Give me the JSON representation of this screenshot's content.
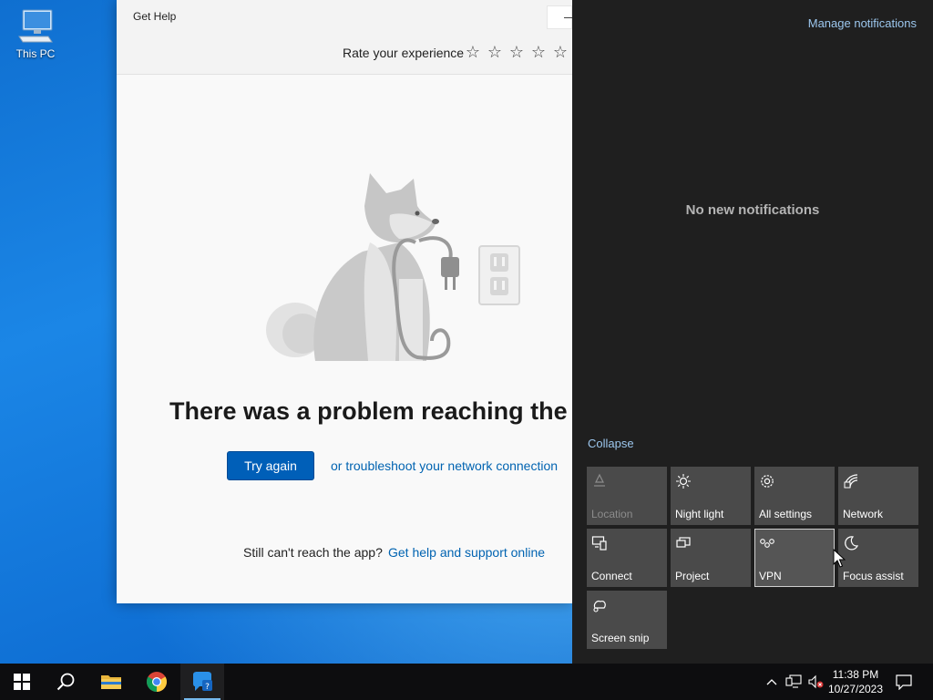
{
  "desktop": {
    "icons": [
      {
        "label": "This PC",
        "icon": "computer-icon"
      }
    ]
  },
  "get_help": {
    "title": "Get Help",
    "rate_label": "Rate your experience",
    "star_glyph": "☆",
    "rating": {
      "value": 0,
      "max": 5
    },
    "headline": "There was a problem reaching the a",
    "try_again": "Try again",
    "troubleshoot_link": "or troubleshoot your network connection",
    "still_cant": "Still can't reach the app?",
    "help_online_link": "Get help and support online"
  },
  "action_center": {
    "manage_notifications": "Manage notifications",
    "empty_message": "No new notifications",
    "collapse": "Collapse",
    "tiles": [
      {
        "label": "Location",
        "icon": "location-icon",
        "enabled": false
      },
      {
        "label": "Night light",
        "icon": "brightness-icon",
        "enabled": true
      },
      {
        "label": "All settings",
        "icon": "gear-icon",
        "enabled": true
      },
      {
        "label": "Network",
        "icon": "network-icon",
        "enabled": true
      },
      {
        "label": "Connect",
        "icon": "connect-icon",
        "enabled": true
      },
      {
        "label": "Project",
        "icon": "project-icon",
        "enabled": true
      },
      {
        "label": "VPN",
        "icon": "vpn-icon",
        "enabled": true
      },
      {
        "label": "Focus assist",
        "icon": "moon-icon",
        "enabled": true
      },
      {
        "label": "Screen snip",
        "icon": "scissors-icon",
        "enabled": true
      }
    ]
  },
  "taskbar": {
    "apps": [
      {
        "name": "Start",
        "icon": "windows-icon"
      },
      {
        "name": "Search",
        "icon": "search-icon"
      },
      {
        "name": "File Explorer",
        "icon": "folder-icon"
      },
      {
        "name": "Google Chrome",
        "icon": "chrome-icon"
      },
      {
        "name": "Get Help",
        "icon": "get-help-icon",
        "active": true
      }
    ],
    "clock": {
      "time": "11:38 PM",
      "date": "10/27/2023"
    }
  },
  "colors": {
    "accent": "#005fb8",
    "link": "#0063b1",
    "action_center_bg": "#1f1f1f",
    "tile_bg": "#4a4a4a"
  }
}
